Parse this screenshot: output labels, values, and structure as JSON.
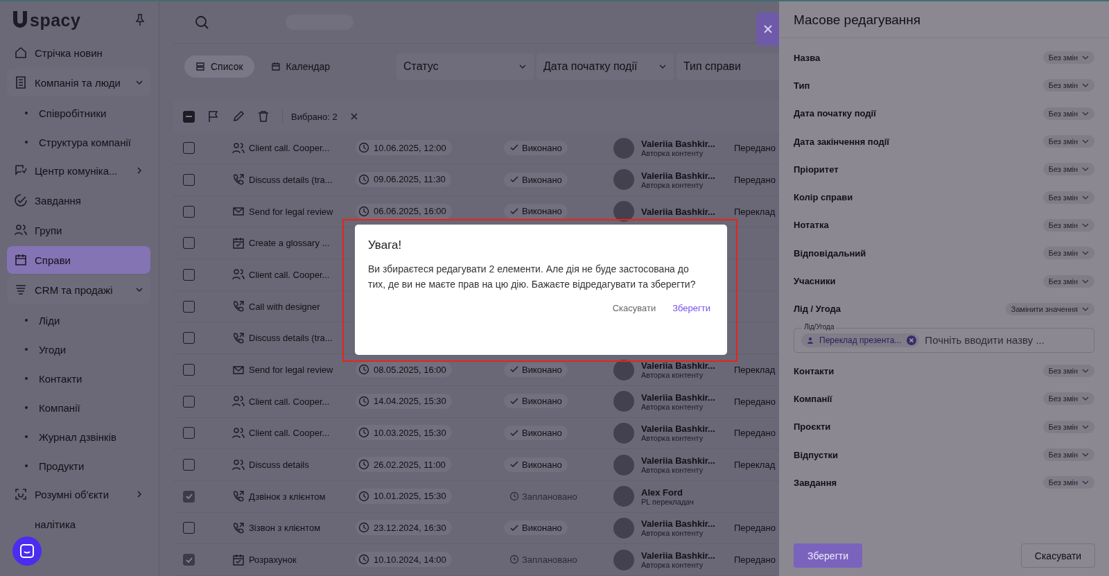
{
  "sidebar": {
    "logo": "spacy",
    "items": [
      {
        "label": "Стрічка новин",
        "kind": "home",
        "selected": false
      },
      {
        "label": "Компанія та люди",
        "kind": "building",
        "selected": false,
        "expanded": true,
        "children": [
          {
            "label": "Співробітники",
            "selected": false
          },
          {
            "label": "Структура компанії",
            "selected": false
          }
        ]
      },
      {
        "label": "Центр комуніка...",
        "kind": "chat",
        "selected": false,
        "expanded": false
      },
      {
        "label": "Завдання",
        "kind": "check",
        "selected": false
      },
      {
        "label": "Групи",
        "kind": "people",
        "selected": false
      },
      {
        "label": "Справи",
        "kind": "calendar",
        "selected": true
      },
      {
        "label": "CRM та продажі",
        "kind": "coins",
        "selected": false,
        "expanded": true,
        "children": [
          {
            "label": "Ліди",
            "selected": false
          },
          {
            "label": "Угоди",
            "selected": false
          },
          {
            "label": "Контакти",
            "selected": false
          },
          {
            "label": "Компанії",
            "selected": false
          },
          {
            "label": "Журнал дзвінків",
            "selected": false
          },
          {
            "label": "Продукти",
            "selected": false
          }
        ]
      },
      {
        "label": "Розумні об'єкти",
        "kind": "scan",
        "selected": false,
        "expanded": false
      },
      {
        "label": "налітика",
        "kind": "plain",
        "selected": false
      }
    ]
  },
  "view_tabs": [
    {
      "label": "Список",
      "kind": "list",
      "selected": true
    },
    {
      "label": "Календар",
      "kind": "calendar",
      "selected": false
    }
  ],
  "filters": [
    {
      "label": "Статус",
      "dropdown": true
    },
    {
      "label": "Дата початку події",
      "dropdown": true
    },
    {
      "label": "Тип справи"
    }
  ],
  "toolbar": {
    "indeterminate": true,
    "selected_count": "Вибрано: 2"
  },
  "rows": [
    {
      "checked": false,
      "kind": "meeting",
      "title": "Client call. Cooper...",
      "date": "10.06.2025, 12:00",
      "status": {
        "label": "Виконано",
        "kind": "done"
      },
      "person": "Valeriia Bashkir...",
      "role": "Авторка контенту",
      "column_6": "Передано"
    },
    {
      "checked": false,
      "kind": "call",
      "title": "Discuss details (tra...",
      "date": "09.06.2025, 11:30",
      "status": {
        "label": "Виконано",
        "kind": "done"
      },
      "person": "Valeriia Bashkir...",
      "role": "Авторка контенту",
      "column_6": "Передано"
    },
    {
      "checked": false,
      "kind": "email",
      "title": "Send for legal review",
      "date": "06.06.2025, 16:00",
      "status": {
        "label": "Виконано",
        "kind": "done"
      },
      "person": "Valeriia Bashkir...",
      "column_6": "Переклад"
    },
    {
      "checked": false,
      "kind": "task",
      "title": "Create a glossary ..."
    },
    {
      "checked": false,
      "kind": "meeting",
      "title": "Client call. Cooper..."
    },
    {
      "checked": false,
      "kind": "call",
      "title": "Call with designer"
    },
    {
      "checked": false,
      "kind": "call",
      "title": "Discuss details (tra..."
    },
    {
      "checked": false,
      "kind": "email",
      "title": "Send for legal review",
      "date": "08.05.2025, 16:00",
      "status": {
        "label": "Виконано",
        "kind": "done"
      },
      "person": "Valeriia Bashkir...",
      "role": "Авторка контенту",
      "column_6": "Переклад"
    },
    {
      "checked": false,
      "kind": "meeting",
      "title": "Client call. Cooper...",
      "date": "14.04.2025, 15:30",
      "status": {
        "label": "Виконано",
        "kind": "done"
      },
      "person": "Valeriia Bashkir...",
      "role": "Авторка контенту",
      "column_6": "Передано"
    },
    {
      "checked": false,
      "kind": "meeting",
      "title": "Client call. Cooper...",
      "date": "10.03.2025, 15:30",
      "status": {
        "label": "Виконано",
        "kind": "done"
      },
      "person": "Valeriia Bashkir...",
      "role": "Авторка контенту",
      "column_6": "Передано"
    },
    {
      "checked": false,
      "kind": "meeting",
      "title": "Discuss details",
      "date": "26.02.2025, 11:00",
      "status": {
        "label": "Виконано",
        "kind": "done"
      },
      "person": "Valeriia Bashkir...",
      "role": "Авторка контенту",
      "column_6": "Переклад"
    },
    {
      "checked": true,
      "kind": "call",
      "title": "Дзвінок з клієнтом",
      "date": "10.01.2025, 15:30",
      "status": {
        "label": "Заплановано",
        "kind": "planned"
      },
      "person": "Alex Ford",
      "role": "PL перекладач"
    },
    {
      "checked": false,
      "kind": "call",
      "title": "Зізвон з клієнтом",
      "date": "23.12.2024, 16:30",
      "status": {
        "label": "Виконано",
        "kind": "done"
      },
      "person": "Valeriia Bashkir...",
      "role": "Авторка контенту",
      "column_6": "Передано"
    },
    {
      "checked": true,
      "kind": "task",
      "title": "Розрахунок",
      "date": "10.10.2024, 14:00",
      "status": {
        "label": "Заплановано",
        "kind": "planned"
      },
      "person": "Valeriia Bashkir...",
      "role": "Авторка контенту",
      "column_6": "Передано"
    }
  ],
  "bulk_edit": {
    "title": "Масове редагування",
    "fields": [
      {
        "kind": "select",
        "label": "Назва",
        "value": "Без змін"
      },
      {
        "kind": "select",
        "label": "Тип",
        "value": "Без змін"
      },
      {
        "kind": "select",
        "label": "Дата початку події",
        "value": "Без змін"
      },
      {
        "kind": "select",
        "label": "Дата закінчення події",
        "value": "Без змін"
      },
      {
        "kind": "select",
        "label": "Пріоритет",
        "value": "Без змін"
      },
      {
        "kind": "select",
        "label": "Колір справи",
        "value": "Без змін"
      },
      {
        "kind": "select",
        "label": "Нотатка",
        "value": "Без змін"
      },
      {
        "kind": "select",
        "label": "Відповідальний",
        "value": "Без змін"
      },
      {
        "kind": "select",
        "label": "Учасники",
        "value": "Без змін"
      },
      {
        "kind": "lookup",
        "label": "Лід / Угода",
        "value": "Замінити значення",
        "field_label": "Лід/Угода",
        "chip": "Переклад презента...",
        "placeholder": "Почніть вводити назву ..."
      },
      {
        "kind": "select",
        "label": "Контакти",
        "value": "Без змін"
      },
      {
        "kind": "select",
        "label": "Компанії",
        "value": "Без змін"
      },
      {
        "kind": "select",
        "label": "Проєкти",
        "value": "Без змін"
      },
      {
        "kind": "select",
        "label": "Відпустки",
        "value": "Без змін"
      },
      {
        "kind": "select",
        "label": "Завдання",
        "value": "Без змін"
      }
    ],
    "save": "Зберегти",
    "cancel": "Скасувати"
  },
  "dialog": {
    "title": "Увага!",
    "message": "Ви збираєтеся редагувати 2 елементи. Але дія не буде застосована до тих, де ви не маєте прав на цю дію. Бажаєте відредагувати та зберегти?",
    "cancel": "Скасувати",
    "confirm": "Зберегти"
  }
}
